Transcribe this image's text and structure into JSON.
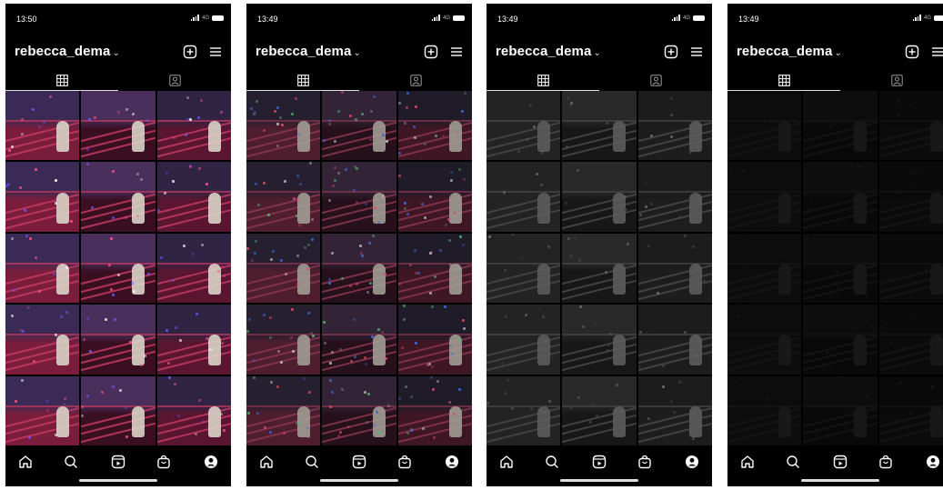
{
  "phones": [
    {
      "time": "13:50",
      "network": "4G",
      "username": "rebecca_dema",
      "variant": "color",
      "dim": 1.0
    },
    {
      "time": "13:49",
      "network": "4G",
      "username": "rebecca_dema",
      "variant": "noisy",
      "dim": 0.85
    },
    {
      "time": "13:49",
      "network": "4G",
      "username": "rebecca_dema",
      "variant": "gray",
      "dim": 0.6
    },
    {
      "time": "13:49",
      "network": "4G",
      "username": "rebecca_dema",
      "variant": "dark",
      "dim": 0.35
    }
  ],
  "icons": {
    "chevron": "chevron-down-icon",
    "new_post": "plus-square-icon",
    "menu": "hamburger-menu-icon",
    "grid_tab": "grid-icon",
    "tagged_tab": "tagged-person-icon",
    "nav": [
      "home-icon",
      "search-icon",
      "reels-icon",
      "shop-icon",
      "profile-icon"
    ]
  },
  "colors": {
    "background": "#000000",
    "foreground": "#ffffff",
    "photo_accent": "#8b1e3f"
  }
}
